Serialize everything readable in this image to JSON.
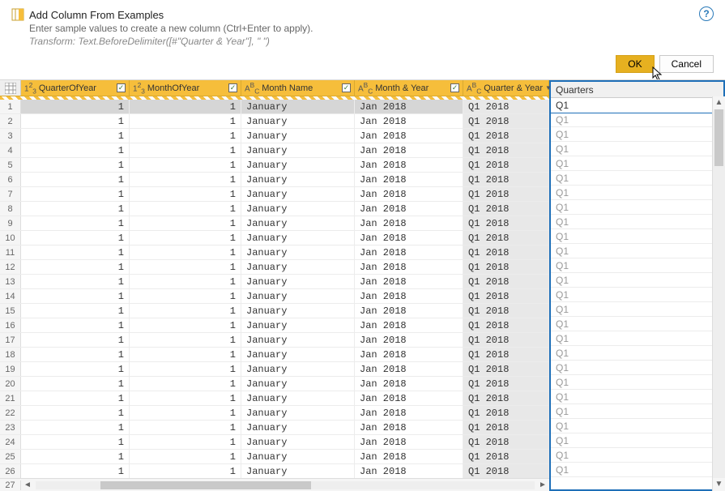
{
  "header": {
    "title": "Add Column From Examples",
    "subtitle": "Enter sample values to create a new column (Ctrl+Enter to apply).",
    "formula": "Transform: Text.BeforeDelimiter([#\"Quarter & Year\"], \" \")"
  },
  "buttons": {
    "ok": "OK",
    "cancel": "Cancel"
  },
  "help_tooltip": "?",
  "columns": {
    "quarterOfYear": {
      "label": "QuarterOfYear",
      "type": "1²₃"
    },
    "monthOfYear": {
      "label": "MonthOfYear",
      "type": "1²₃"
    },
    "monthName": {
      "label": "Month Name",
      "type": "AᴮC"
    },
    "monthYear": {
      "label": "Month & Year",
      "type": "AᴮC"
    },
    "quarterYear": {
      "label": "Quarter & Year",
      "type": "AᴮC"
    }
  },
  "new_column_header": "Quarters",
  "row_count": 27,
  "sample_row": {
    "quarterOfYear": "1",
    "monthOfYear": "1",
    "monthName": "January",
    "monthYear": "Jan 2018",
    "quarterYear": "Q1 2018"
  },
  "new_column_first_value": "Q1",
  "new_column_suggested": "Q1",
  "colors": {
    "accent_yellow": "#f6be3b",
    "highlight_blue": "#1e6fb8",
    "ok_button": "#e6b020"
  }
}
